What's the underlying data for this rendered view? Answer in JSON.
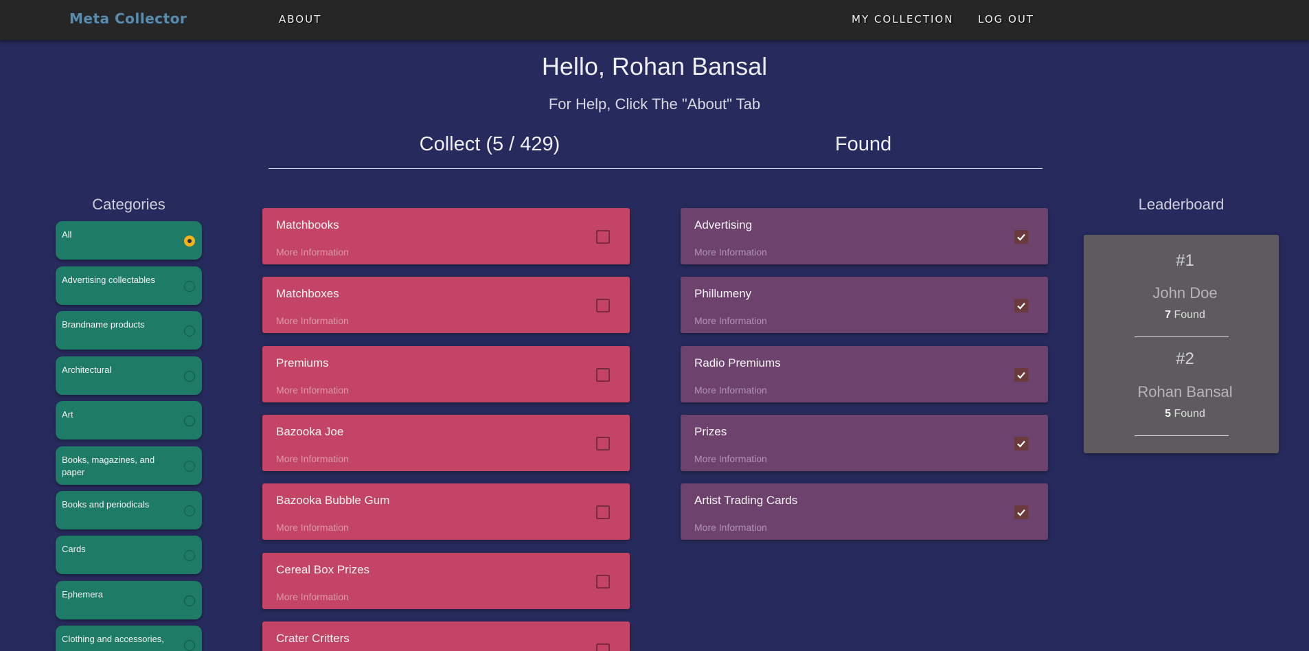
{
  "nav": {
    "brand": "Meta Collector",
    "about": "ABOUT",
    "my_collection": "MY COLLECTION",
    "logout": "LOG OUT"
  },
  "header": {
    "greeting": "Hello, Rohan Bansal",
    "help": "For Help, Click The \"About\" Tab",
    "collect_title": "Collect (5 / 429)",
    "found_title": "Found"
  },
  "categories": {
    "heading": "Categories",
    "selected": "All",
    "items": [
      "All",
      "Advertising collectables",
      "Brandname products",
      "Architectural",
      "Art",
      "Books, magazines, and paper",
      "Books and periodicals",
      "Cards",
      "Ephemera",
      "Clothing and accessories,"
    ]
  },
  "collect": {
    "more_label": "More Information",
    "items": [
      "Matchbooks",
      "Matchboxes",
      "Premiums",
      "Bazooka Joe",
      "Bazooka Bubble Gum",
      "Cereal Box Prizes",
      "Crater Critters"
    ]
  },
  "found": {
    "more_label": "More Information",
    "items": [
      "Advertising",
      "Phillumeny",
      "Radio Premiums",
      "Prizes",
      "Artist Trading Cards"
    ]
  },
  "leaderboard": {
    "heading": "Leaderboard",
    "found_label": "Found",
    "entries": [
      {
        "rank": "#1",
        "name": "John Doe",
        "count": "7"
      },
      {
        "rank": "#2",
        "name": "Rohan Bansal",
        "count": "5"
      }
    ]
  },
  "colors": {
    "background": "#272a5c",
    "navbar": "#262626",
    "category": "#1e7b65",
    "collect_card": "#c34464",
    "found_card": "#6d436e",
    "leaderboard": "#5e5b5e",
    "radio_selected": "#f6b21b"
  }
}
